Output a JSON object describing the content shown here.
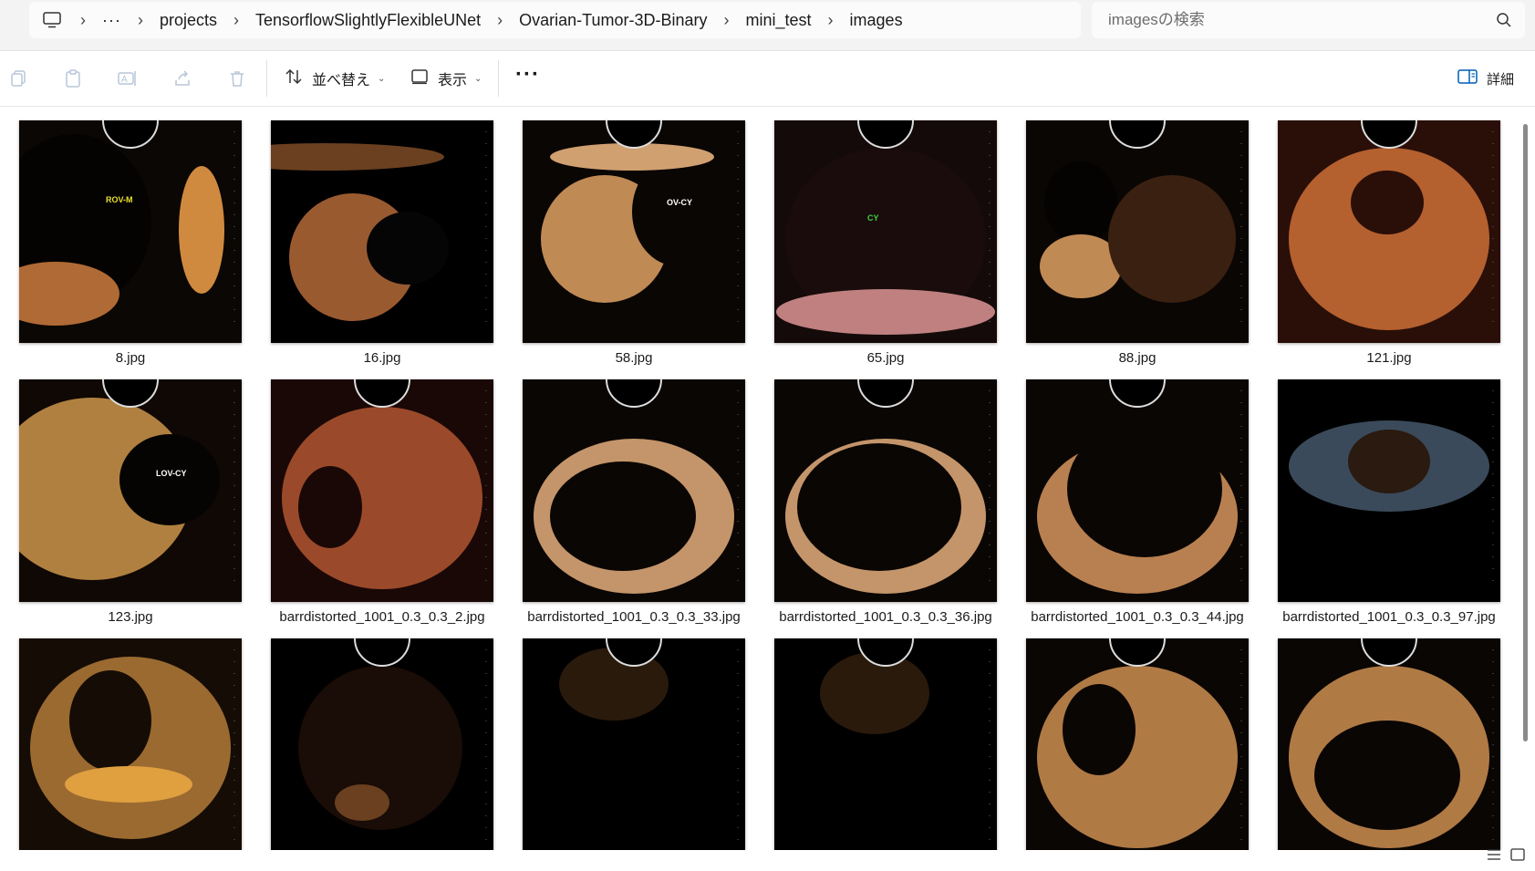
{
  "addressbar": {
    "breadcrumbs": [
      "projects",
      "TensorflowSlightlyFlexibleUNet",
      "Ovarian-Tumor-3D-Binary",
      "mini_test",
      "images"
    ],
    "overflow": "···"
  },
  "search": {
    "placeholder": "imagesの検索"
  },
  "toolbar": {
    "sort_label": "並べ替え",
    "view_label": "表示",
    "more": "···",
    "details_label": "詳細"
  },
  "files": [
    {
      "name": "8.jpg",
      "annotation": "ROV-M"
    },
    {
      "name": "16.jpg",
      "annotation": ""
    },
    {
      "name": "58.jpg",
      "annotation": "OV-CY"
    },
    {
      "name": "65.jpg",
      "annotation": "CY"
    },
    {
      "name": "88.jpg",
      "annotation": ""
    },
    {
      "name": "121.jpg",
      "annotation": ""
    },
    {
      "name": "123.jpg",
      "annotation": "LOV-CY"
    },
    {
      "name": "barrdistorted_1001_0.3_0.3_2.jpg",
      "annotation": ""
    },
    {
      "name": "barrdistorted_1001_0.3_0.3_33.jpg",
      "annotation": ""
    },
    {
      "name": "barrdistorted_1001_0.3_0.3_36.jpg",
      "annotation": ""
    },
    {
      "name": "barrdistorted_1001_0.3_0.3_44.jpg",
      "annotation": ""
    },
    {
      "name": "barrdistorted_1001_0.3_0.3_97.jpg",
      "annotation": ""
    },
    {
      "name": "",
      "annotation": ""
    },
    {
      "name": "",
      "annotation": ""
    },
    {
      "name": "",
      "annotation": ""
    },
    {
      "name": "",
      "annotation": ""
    },
    {
      "name": "",
      "annotation": ""
    },
    {
      "name": "",
      "annotation": ""
    }
  ],
  "colors": {
    "accent": "#005fb8",
    "thumb_bg": "#000000",
    "tissue": "#c98a4a"
  }
}
